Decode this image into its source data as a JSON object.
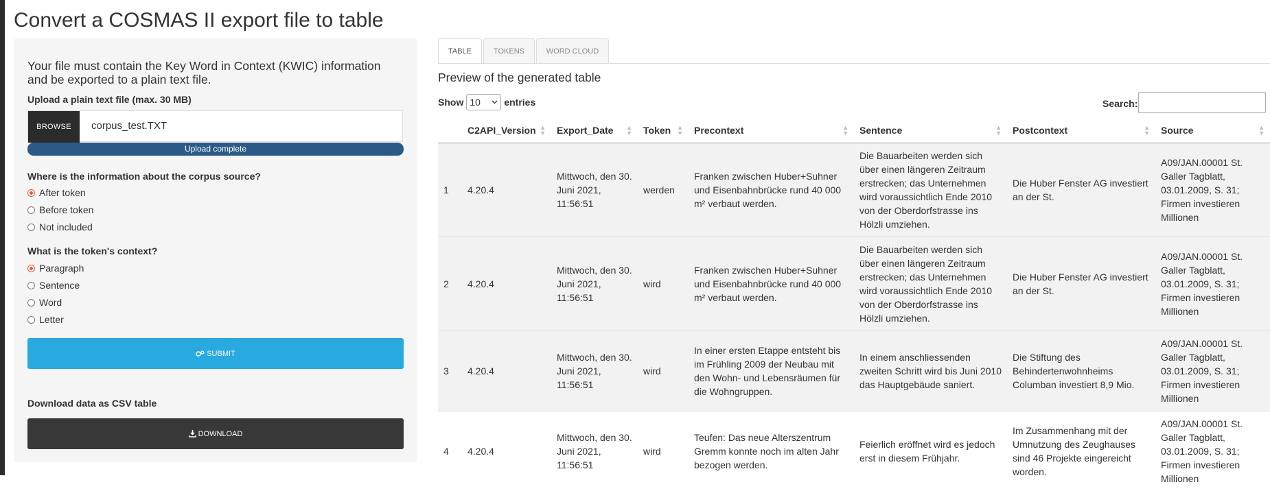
{
  "page_title": "Convert a COSMAS II export file to table",
  "intro": "Your file must contain the Key Word in Context (KWIC) information and be exported to a plain text file.",
  "upload": {
    "label": "Upload a plain text file (max. 30 MB)",
    "browse_label": "BROWSE",
    "filename": "corpus_test.TXT",
    "status": "Upload complete",
    "progress": 1.0
  },
  "source_question": {
    "label": "Where is the information about the corpus source?",
    "options": [
      "After token",
      "Before token",
      "Not included"
    ],
    "selected": "After token"
  },
  "context_question": {
    "label": "What is the token's context?",
    "options": [
      "Paragraph",
      "Sentence",
      "Word",
      "Letter"
    ],
    "selected": "Paragraph"
  },
  "submit_label": "SUBMIT",
  "download": {
    "label": "Download data as CSV table",
    "button_label": "DOWNLOAD"
  },
  "tabs": [
    "TABLE",
    "TOKENS",
    "WORD CLOUD"
  ],
  "active_tab": "TABLE",
  "preview_title": "Preview of the generated table",
  "length": {
    "show": "Show",
    "value": "10",
    "entries": "entries"
  },
  "search_label": "Search:",
  "search_value": "",
  "table": {
    "columns": [
      "",
      "C2API_Version",
      "Export_Date",
      "Token",
      "Precontext",
      "Sentence",
      "Postcontext",
      "Source"
    ],
    "rows": [
      [
        "1",
        "4.20.4",
        "Mittwoch, den 30. Juni 2021, 11:56:51",
        "werden",
        "Franken zwischen Huber+Suhner und Eisenbahnbrücke rund 40 000 m² verbaut werden.",
        "Die Bauarbeiten werden sich über einen längeren Zeitraum erstrecken; das Unternehmen wird voraussichtlich Ende 2010 von der Oberdorfstrasse ins Hölzli umziehen.",
        "Die Huber Fenster AG investiert an der St.",
        "A09/JAN.00001 St. Galler Tagblatt, 03.01.2009, S. 31; Firmen investieren Millionen"
      ],
      [
        "2",
        "4.20.4",
        "Mittwoch, den 30. Juni 2021, 11:56:51",
        "wird",
        "Franken zwischen Huber+Suhner und Eisenbahnbrücke rund 40 000 m² verbaut werden.",
        "Die Bauarbeiten werden sich über einen längeren Zeitraum erstrecken; das Unternehmen wird voraussichtlich Ende 2010 von der Oberdorfstrasse ins Hölzli umziehen.",
        "Die Huber Fenster AG investiert an der St.",
        "A09/JAN.00001 St. Galler Tagblatt, 03.01.2009, S. 31; Firmen investieren Millionen"
      ],
      [
        "3",
        "4.20.4",
        "Mittwoch, den 30. Juni 2021, 11:56:51",
        "wird",
        "In einer ersten Etappe entsteht bis im Frühling 2009 der Neubau mit den Wohn- und Lebensräumen für die Wohngruppen.",
        "In einem anschliessenden zweiten Schritt wird bis Juni 2010 das Hauptgebäude saniert.",
        "Die Stiftung des Behindertenwohnheims Columban investiert 8,9 Mio.",
        "A09/JAN.00001 St. Galler Tagblatt, 03.01.2009, S. 31; Firmen investieren Millionen"
      ],
      [
        "4",
        "4.20.4",
        "Mittwoch, den 30. Juni 2021, 11:56:51",
        "wird",
        "Teufen: Das neue Alterszentrum Gremm konnte noch im alten Jahr bezogen werden.",
        "Feierlich eröffnet wird es jedoch erst in diesem Frühjahr.",
        "Im Zusammenhang mit der Umnutzung des Zeughauses sind 46 Projekte eingereicht worden.",
        "A09/JAN.00001 St. Galler Tagblatt, 03.01.2009, S. 31; Firmen investieren Millionen"
      ]
    ]
  },
  "colors": {
    "accent_radio": "#e65a2b",
    "submit_bg": "#28a9df",
    "download_bg": "#383838",
    "progress_bg": "#2c5a88"
  },
  "icons": {
    "submit": "gears-icon",
    "download": "download-icon",
    "select": "chevron-down-icon"
  }
}
